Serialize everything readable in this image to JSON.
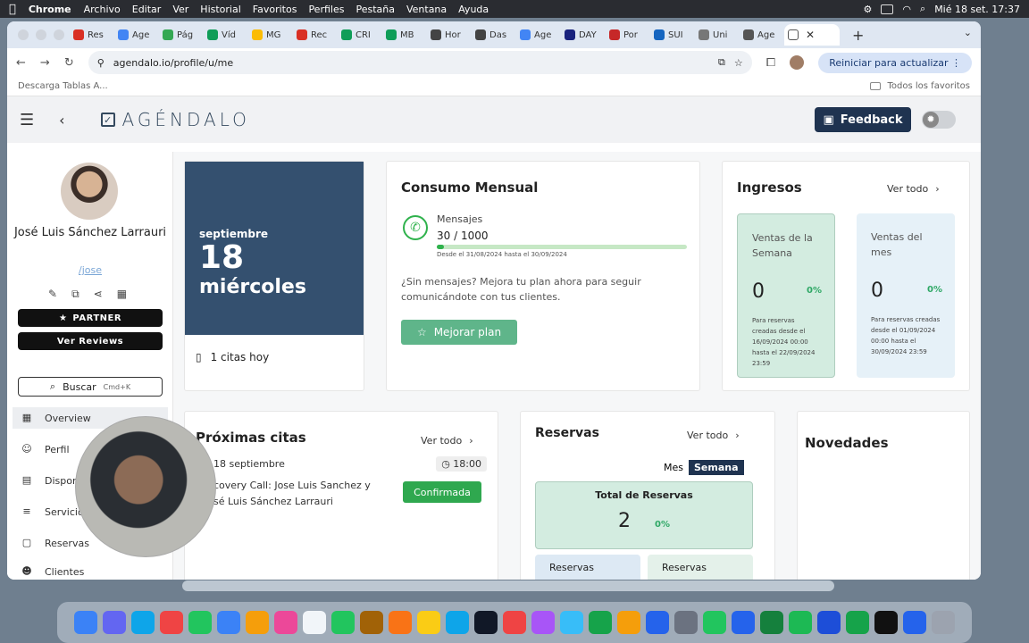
{
  "menubar": {
    "app": "Chrome",
    "items": [
      "Archivo",
      "Editar",
      "Ver",
      "Historial",
      "Favoritos",
      "Perfiles",
      "Pestaña",
      "Ventana",
      "Ayuda"
    ],
    "clock": "Mié 18 set.  17:37"
  },
  "tabs": [
    {
      "label": "Res",
      "color": "#d93025"
    },
    {
      "label": "Age",
      "color": "#4285f4"
    },
    {
      "label": "Pág",
      "color": "#34a853"
    },
    {
      "label": "Víd",
      "color": "#0f9d58"
    },
    {
      "label": "MG",
      "color": "#fbbc05"
    },
    {
      "label": "Rec",
      "color": "#d93025"
    },
    {
      "label": "CRI",
      "color": "#0f9d58"
    },
    {
      "label": "MB",
      "color": "#0f9d58"
    },
    {
      "label": "Hor",
      "color": "#444444"
    },
    {
      "label": "Das",
      "color": "#444444"
    },
    {
      "label": "Age",
      "color": "#4285f4"
    },
    {
      "label": "DAY",
      "color": "#1a237e"
    },
    {
      "label": "Por",
      "color": "#c62828"
    },
    {
      "label": "SUI",
      "color": "#1565c0"
    },
    {
      "label": "Uni",
      "color": "#777777"
    },
    {
      "label": "Age",
      "color": "#555555"
    }
  ],
  "browser": {
    "url": "agendalo.io/profile/u/me",
    "restart": "Reiniciar para actualizar",
    "bookmark_left": "Descarga Tablas A...",
    "bookmark_right": "Todos los favoritos"
  },
  "header": {
    "logo": "AGÉNDALO",
    "feedback": "Feedback"
  },
  "profile": {
    "name": "José Luis Sánchez Larrauri",
    "handle": "/jose",
    "partner": "PARTNER",
    "reviews": "Ver Reviews",
    "search": "Buscar",
    "search_kbd": "Cmd+K"
  },
  "nav": [
    "Overview",
    "Perfil",
    "Dispon",
    "Servicio",
    "Reservas",
    "Clientes"
  ],
  "date": {
    "month": "septiembre",
    "day": "18",
    "weekday": "miércoles",
    "citas": "1 citas hoy"
  },
  "consumo": {
    "title": "Consumo Mensual",
    "label": "Mensajes",
    "count": "30 / 1000",
    "progress": 0.03,
    "range": "Desde el 31/08/2024 hasta el 30/09/2024",
    "upsell": "¿Sin mensajes? Mejora tu plan ahora para seguir comunicándote con tus clientes.",
    "button": "Mejorar plan"
  },
  "ingresos": {
    "title": "Ingresos",
    "ver_todo": "Ver todo",
    "tiles": [
      {
        "title": "Ventas de la Semana",
        "value": "0",
        "pct": "0%",
        "note": "Para reservas creadas desde el 16/09/2024 00:00 hasta el 22/09/2024 23:59",
        "bg": "#d3ece0"
      },
      {
        "title": "Ventas del mes",
        "value": "0",
        "pct": "0%",
        "note": "Para reservas creadas desde el 01/09/2024 00:00 hasta el 30/09/2024 23:59",
        "bg": "#e6f1f8"
      }
    ]
  },
  "proximas": {
    "title": "Próximas citas",
    "ver_todo": "Ver todo",
    "date": "18 septiembre",
    "time": "18:00",
    "desc": "covery Call: Jose Luis Sanchez y sé Luis Sánchez Larrauri",
    "status": "Confirmada"
  },
  "reservas": {
    "title": "Reservas",
    "ver_todo": "Ver todo",
    "seg_mes": "Mes",
    "seg_semana": "Semana",
    "total_title": "Total de Reservas",
    "total_value": "2",
    "total_pct": "0%",
    "sub1": "Reservas",
    "sub2": "Reservas"
  },
  "novedades": {
    "title": "Novedades"
  }
}
